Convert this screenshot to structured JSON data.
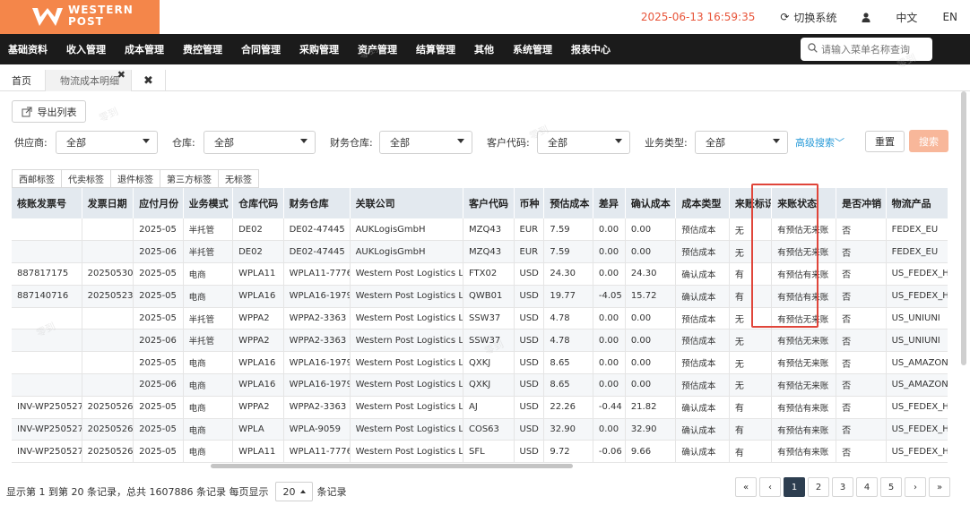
{
  "brand": {
    "line1": "WESTERN",
    "line2": "POST",
    "color": "#f4864a"
  },
  "header": {
    "datetime": "2025-06-13 16:59:35",
    "switch_system": "切换系统",
    "lang_cn": "中文",
    "lang_en": "EN"
  },
  "nav": {
    "items": [
      "基础资料",
      "收入管理",
      "成本管理",
      "费控管理",
      "合同管理",
      "采购管理",
      "资产管理",
      "结算管理",
      "其他",
      "系统管理",
      "报表中心"
    ],
    "search_placeholder": "请输入菜单名称查询"
  },
  "page_tabs": {
    "home": "首页",
    "current": "物流成本明细",
    "x": "✖"
  },
  "toolbar": {
    "export": "导出列表"
  },
  "filters": {
    "supplier_label": "供应商:",
    "supplier": "全部",
    "warehouse_label": "仓库:",
    "warehouse": "全部",
    "fin_wh_label": "财务仓库:",
    "fin_wh": "全部",
    "customer_label": "客户代码:",
    "customer": "全部",
    "biz_label": "业务类型:",
    "biz": "全部",
    "advanced": "高级搜索﹀",
    "reset": "重置",
    "search": "搜索"
  },
  "sub_tabs": [
    "西邮标签",
    "代卖标签",
    "退件标签",
    "第三方标签",
    "无标签"
  ],
  "table": {
    "headers": [
      "核账发票号",
      "发票日期",
      "应付月份",
      "业务模式",
      "仓库代码",
      "财务仓库",
      "关联公司",
      "客户代码",
      "币种",
      "预估成本",
      "差异",
      "确认成本",
      "成本类型",
      "来账标识",
      "来账状态",
      "是否冲销",
      "物流产品"
    ],
    "rows": [
      [
        "",
        "",
        "2025-05",
        "半托管",
        "DE02",
        "DE02-47445",
        "AUKLogisGmbH",
        "MZQ43",
        "EUR",
        "7.59",
        "0.00",
        "0.00",
        "预估成本",
        "无",
        "有预估无来账",
        "否",
        "FEDEX_EU"
      ],
      [
        "",
        "",
        "2025-06",
        "半托管",
        "DE02",
        "DE02-47445",
        "AUKLogisGmbH",
        "MZQ43",
        "EUR",
        "7.59",
        "0.00",
        "0.00",
        "预估成本",
        "无",
        "有预估无来账",
        "否",
        "FEDEX_EU"
      ],
      [
        "887817175",
        "20250530",
        "2025-05",
        "电商",
        "WPLA11",
        "WPLA11-7776",
        "Western Post Logistics LLC",
        "FTX02",
        "USD",
        "24.30",
        "0.00",
        "24.30",
        "确认成本",
        "有",
        "有预估有来账",
        "否",
        "US_FEDEX_HD"
      ],
      [
        "887140716",
        "20250523",
        "2025-05",
        "电商",
        "WPLA16",
        "WPLA16-1979",
        "Western Post Logistics LLC",
        "QWB01",
        "USD",
        "19.77",
        "-4.05",
        "15.72",
        "确认成本",
        "有",
        "有预估有来账",
        "否",
        "US_FEDEX_HD"
      ],
      [
        "",
        "",
        "2025-05",
        "半托管",
        "WPPA2",
        "WPPA2-3363",
        "Western Post Logistics LLC",
        "SSW37",
        "USD",
        "4.78",
        "0.00",
        "0.00",
        "预估成本",
        "无",
        "有预估无来账",
        "否",
        "US_UNIUNI"
      ],
      [
        "",
        "",
        "2025-06",
        "半托管",
        "WPPA2",
        "WPPA2-3363",
        "Western Post Logistics LLC",
        "SSW37",
        "USD",
        "4.78",
        "0.00",
        "0.00",
        "预估成本",
        "无",
        "有预估无来账",
        "否",
        "US_UNIUNI"
      ],
      [
        "",
        "",
        "2025-05",
        "电商",
        "WPLA16",
        "WPLA16-1979",
        "Western Post Logistics LLC",
        "QXKJ",
        "USD",
        "8.65",
        "0.00",
        "0.00",
        "预估成本",
        "无",
        "有预估无来账",
        "否",
        "US_AMAZON_GROU"
      ],
      [
        "",
        "",
        "2025-06",
        "电商",
        "WPLA16",
        "WPLA16-1979",
        "Western Post Logistics LLC",
        "QXKJ",
        "USD",
        "8.65",
        "0.00",
        "0.00",
        "预估成本",
        "无",
        "有预估无来账",
        "否",
        "US_AMAZON_GROU"
      ],
      [
        "INV-WP250527",
        "20250526",
        "2025-05",
        "电商",
        "WPPA2",
        "WPPA2-3363",
        "Western Post Logistics LLC",
        "AJ",
        "USD",
        "22.26",
        "-0.44",
        "21.82",
        "确认成本",
        "有",
        "有预估有来账",
        "否",
        "US_FEDEX_HD_A"
      ],
      [
        "INV-WP250527",
        "20250526",
        "2025-05",
        "电商",
        "WPLA",
        "WPLA-9059",
        "Western Post Logistics LLC",
        "COS63",
        "USD",
        "32.90",
        "0.00",
        "32.90",
        "确认成本",
        "有",
        "有预估有来账",
        "否",
        "US_FEDEX_HD_A"
      ],
      [
        "INV-WP250527",
        "20250526",
        "2025-05",
        "电商",
        "WPLA11",
        "WPLA11-7776",
        "Western Post Logistics LLC",
        "SFL",
        "USD",
        "9.72",
        "-0.06",
        "9.66",
        "确认成本",
        "有",
        "有预估有来账",
        "否",
        "US_FEDEX_HD_A"
      ]
    ]
  },
  "footer": {
    "summary_left": "显示第 1 到第 20 条记录，总共 1607886 条记录 每页显示",
    "page_size": "20",
    "summary_right": "条记录",
    "pages": [
      "«",
      "‹",
      "1",
      "2",
      "3",
      "4",
      "5",
      "›",
      "»"
    ],
    "active_page": "1"
  },
  "watermark": "零到",
  "highlight_color": "#e0453a"
}
